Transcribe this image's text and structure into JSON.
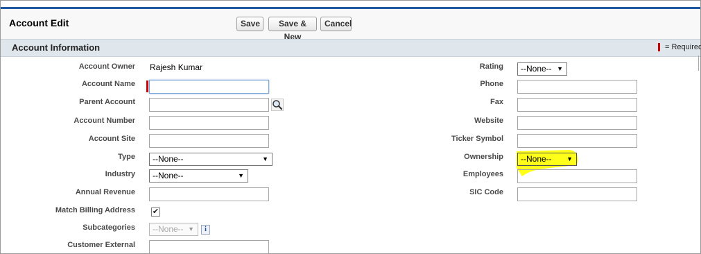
{
  "page": {
    "title": "Account Edit",
    "buttons": {
      "save": "Save",
      "save_new": "Save & New",
      "cancel": "Cancel"
    }
  },
  "section": {
    "title": "Account Information",
    "required_legend": "= Required"
  },
  "left_fields": {
    "account_owner": {
      "label": "Account Owner",
      "value": "Rajesh Kumar"
    },
    "account_name": {
      "label": "Account Name",
      "value": "",
      "required": true
    },
    "parent_account": {
      "label": "Parent Account",
      "value": ""
    },
    "account_number": {
      "label": "Account Number",
      "value": ""
    },
    "account_site": {
      "label": "Account Site",
      "value": ""
    },
    "type": {
      "label": "Type",
      "selected": "--None--"
    },
    "industry": {
      "label": "Industry",
      "selected": "--None--"
    },
    "annual_revenue": {
      "label": "Annual Revenue",
      "value": ""
    },
    "match_billing_address": {
      "label": "Match Billing Address",
      "checked": true,
      "check_glyph": "✔"
    },
    "subcategories": {
      "label": "Subcategories",
      "selected": "--None--",
      "disabled": true,
      "info_glyph": "i"
    },
    "customer_external": {
      "label": "Customer External",
      "value": ""
    }
  },
  "right_fields": {
    "rating": {
      "label": "Rating",
      "selected": "--None--"
    },
    "phone": {
      "label": "Phone",
      "value": ""
    },
    "fax": {
      "label": "Fax",
      "value": ""
    },
    "website": {
      "label": "Website",
      "value": ""
    },
    "ticker_symbol": {
      "label": "Ticker Symbol",
      "value": ""
    },
    "ownership": {
      "label": "Ownership",
      "selected": "--None--",
      "highlighted": true
    },
    "employees": {
      "label": "Employees",
      "value": ""
    },
    "sic_code": {
      "label": "SIC Code",
      "value": ""
    }
  },
  "icons": {
    "lookup": "magnifier-lookup-icon",
    "dropdown_arrow": "▼",
    "info": "info-icon"
  },
  "colors": {
    "top_rule": "#1f5aa0",
    "section_bar": "#dfe6ec",
    "required": "#cc0000",
    "highlight": "#ffff00"
  }
}
